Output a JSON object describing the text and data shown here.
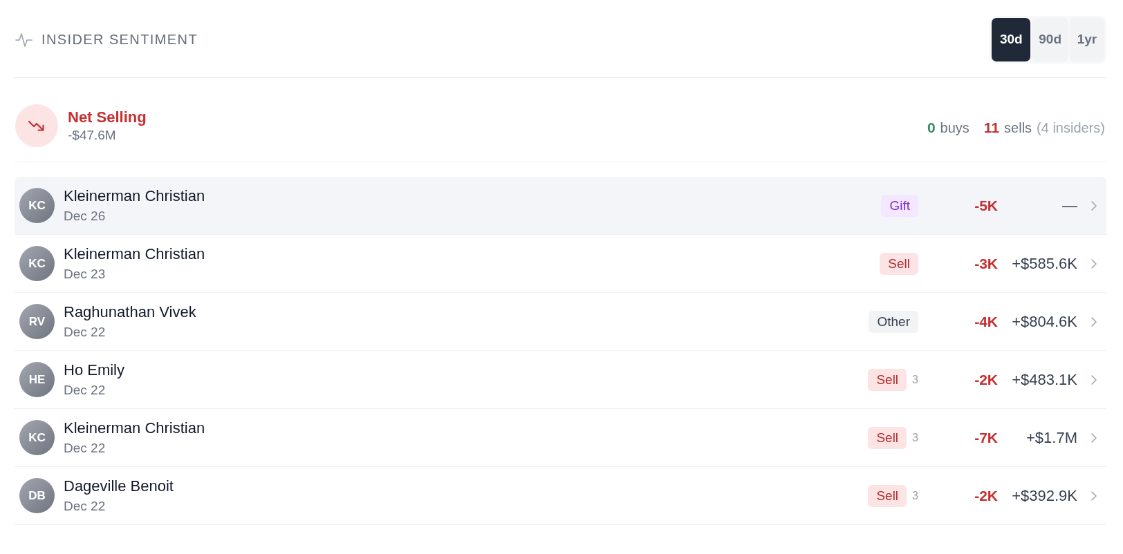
{
  "header": {
    "title": "INSIDER SENTIMENT",
    "periods": [
      {
        "label": "30d",
        "selected": true
      },
      {
        "label": "90d",
        "selected": false
      },
      {
        "label": "1yr",
        "selected": false
      }
    ]
  },
  "summary": {
    "kind": "net_selling",
    "label": "Net Selling",
    "amount": "-$47.6M",
    "buys": {
      "count": "0",
      "label": "buys"
    },
    "sells": {
      "count": "11",
      "label": "sells"
    },
    "insiders": "(4 insiders)"
  },
  "transactions": [
    {
      "initials": "KC",
      "name": "Kleinerman Christian",
      "date": "Dec 26",
      "kind": "gift",
      "type": "Gift",
      "shares": "-5K",
      "value": "—",
      "selected": true
    },
    {
      "initials": "KC",
      "name": "Kleinerman Christian",
      "date": "Dec 23",
      "kind": "sell",
      "type": "Sell",
      "shares": "-3K",
      "value": "+$585.6K",
      "selected": false
    },
    {
      "initials": "RV",
      "name": "Raghunathan Vivek",
      "date": "Dec 22",
      "kind": "other",
      "type": "Other",
      "shares": "-4K",
      "value": "+$804.6K",
      "selected": false
    },
    {
      "initials": "HE",
      "name": "Ho Emily",
      "date": "Dec 22",
      "kind": "sell",
      "type": "Sell",
      "count": "3",
      "shares": "-2K",
      "value": "+$483.1K",
      "selected": false
    },
    {
      "initials": "KC",
      "name": "Kleinerman Christian",
      "date": "Dec 22",
      "kind": "sell",
      "type": "Sell",
      "count": "3",
      "shares": "-7K",
      "value": "+$1.7M",
      "selected": false
    },
    {
      "initials": "DB",
      "name": "Dageville Benoit",
      "date": "Dec 22",
      "kind": "sell",
      "type": "Sell",
      "count": "3",
      "shares": "-2K",
      "value": "+$392.9K",
      "selected": false
    }
  ]
}
